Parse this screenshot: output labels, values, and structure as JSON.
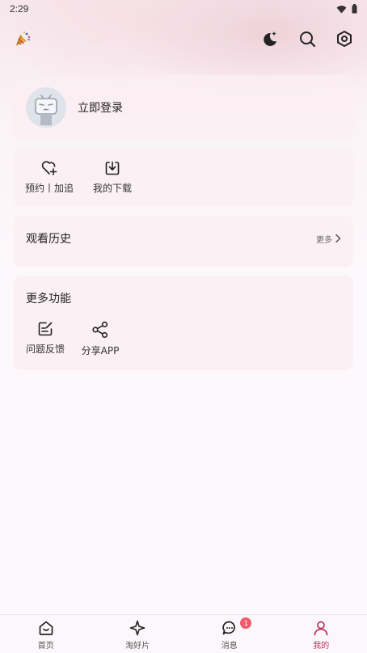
{
  "status_bar": {
    "time": "2:29"
  },
  "login_card": {
    "label": "立即登录"
  },
  "quick_actions": [
    {
      "label": "预约丨加追",
      "icon": "heart-plus-icon"
    },
    {
      "label": "我的下载",
      "icon": "download-icon"
    }
  ],
  "history": {
    "title": "观看历史",
    "more_label": "更多"
  },
  "more_functions": {
    "title": "更多功能",
    "items": [
      {
        "label": "问题反馈",
        "icon": "feedback-icon"
      },
      {
        "label": "分享APP",
        "icon": "share-icon"
      }
    ]
  },
  "tabbar": {
    "items": [
      {
        "label": "首页",
        "icon": "home-icon"
      },
      {
        "label": "淘好片",
        "icon": "sparkle-icon"
      },
      {
        "label": "消息",
        "icon": "message-icon",
        "badge": "1"
      },
      {
        "label": "我的",
        "icon": "profile-icon",
        "active": true
      }
    ]
  },
  "colors": {
    "accent": "#c0305a",
    "badge": "#f05a6e",
    "card_bg": "#faeef2"
  }
}
